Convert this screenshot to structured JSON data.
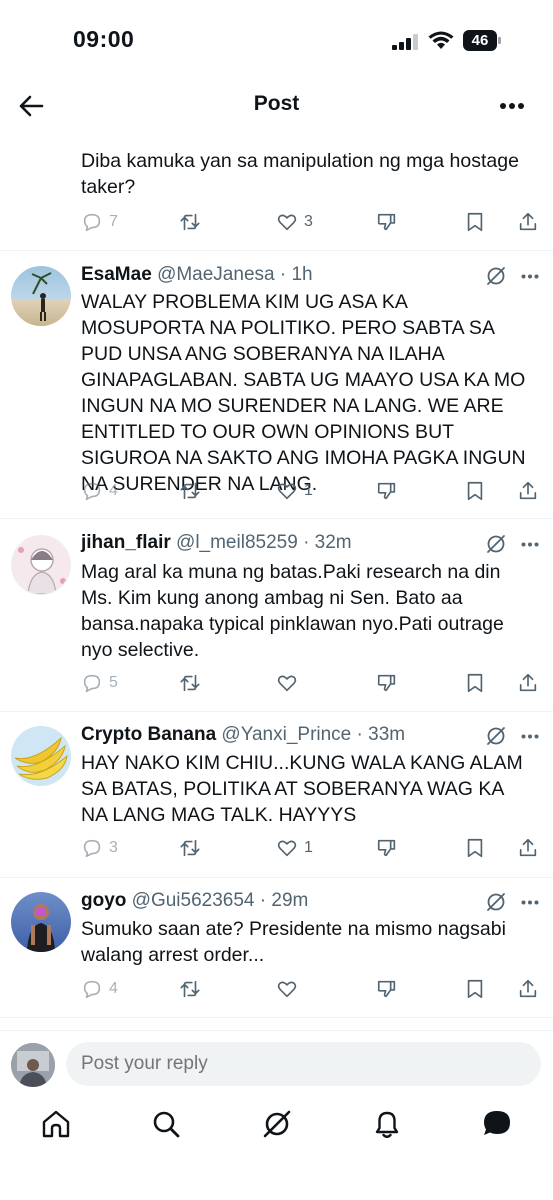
{
  "status_bar": {
    "time": "09:00",
    "battery": "46"
  },
  "header": {
    "title": "Post",
    "back_icon": "back-arrow-icon",
    "more_icon": "more-icon"
  },
  "top_reply": {
    "text": "Diba kamuka yan sa manipulation ng mga hostage taker?",
    "replies": "7",
    "reposts": "",
    "likes": "3"
  },
  "replies": [
    {
      "name": "EsaMae",
      "handle": "@MaeJanesa",
      "time": "· 1h",
      "text": "WALAY PROBLEMA KIM UG ASA KA MOSUPORTA NA POLITIKO. PERO SABTA SA PUD UNSA ANG SOBERANYA NA ILAHA GINAPAGLABAN. SABTA UG MAAYO USA KA MO INGUN NA MO SURENDER NA LANG. WE ARE ENTITLED TO OUR OWN OPINIONS BUT SIGUROA NA SAKTO ANG IMOHA PAGKA INGUN NA SURENDER NA LANG.",
      "replies": "4",
      "likes": "1"
    },
    {
      "name": "jihan_flair",
      "handle": "@l_meil85259",
      "time": "· 32m",
      "text": "Mag aral ka muna ng batas.Paki research na din Ms. Kim kung anong ambag ni Sen. Bato aa bansa.napaka typical pinklawan nyo.Pati outrage nyo selective.",
      "replies": "5",
      "likes": ""
    },
    {
      "name": "Crypto Banana",
      "handle": "@Yanxi_Prince",
      "time": "· 33m",
      "text": "HAY NAKO KIM CHIU...KUNG WALA KANG ALAM SA BATAS, POLITIKA AT SOBERANYA WAG KA NA LANG MAG TALK. HAYYYS",
      "replies": "3",
      "likes": "1"
    },
    {
      "name": "goyo",
      "handle": "@Gui5623654",
      "time": "· 29m",
      "text": "Sumuko saan ate? Presidente na mismo nagsabi walang arrest order...",
      "replies": "4",
      "likes": ""
    }
  ],
  "reply_box": {
    "placeholder": "Post your reply"
  },
  "bottom_nav": [
    "home-icon",
    "search-icon",
    "grok-icon",
    "notifications-icon",
    "messages-icon"
  ],
  "colors": {
    "text": "#0f1419",
    "muted": "#536471",
    "divider": "#eff3f4"
  }
}
